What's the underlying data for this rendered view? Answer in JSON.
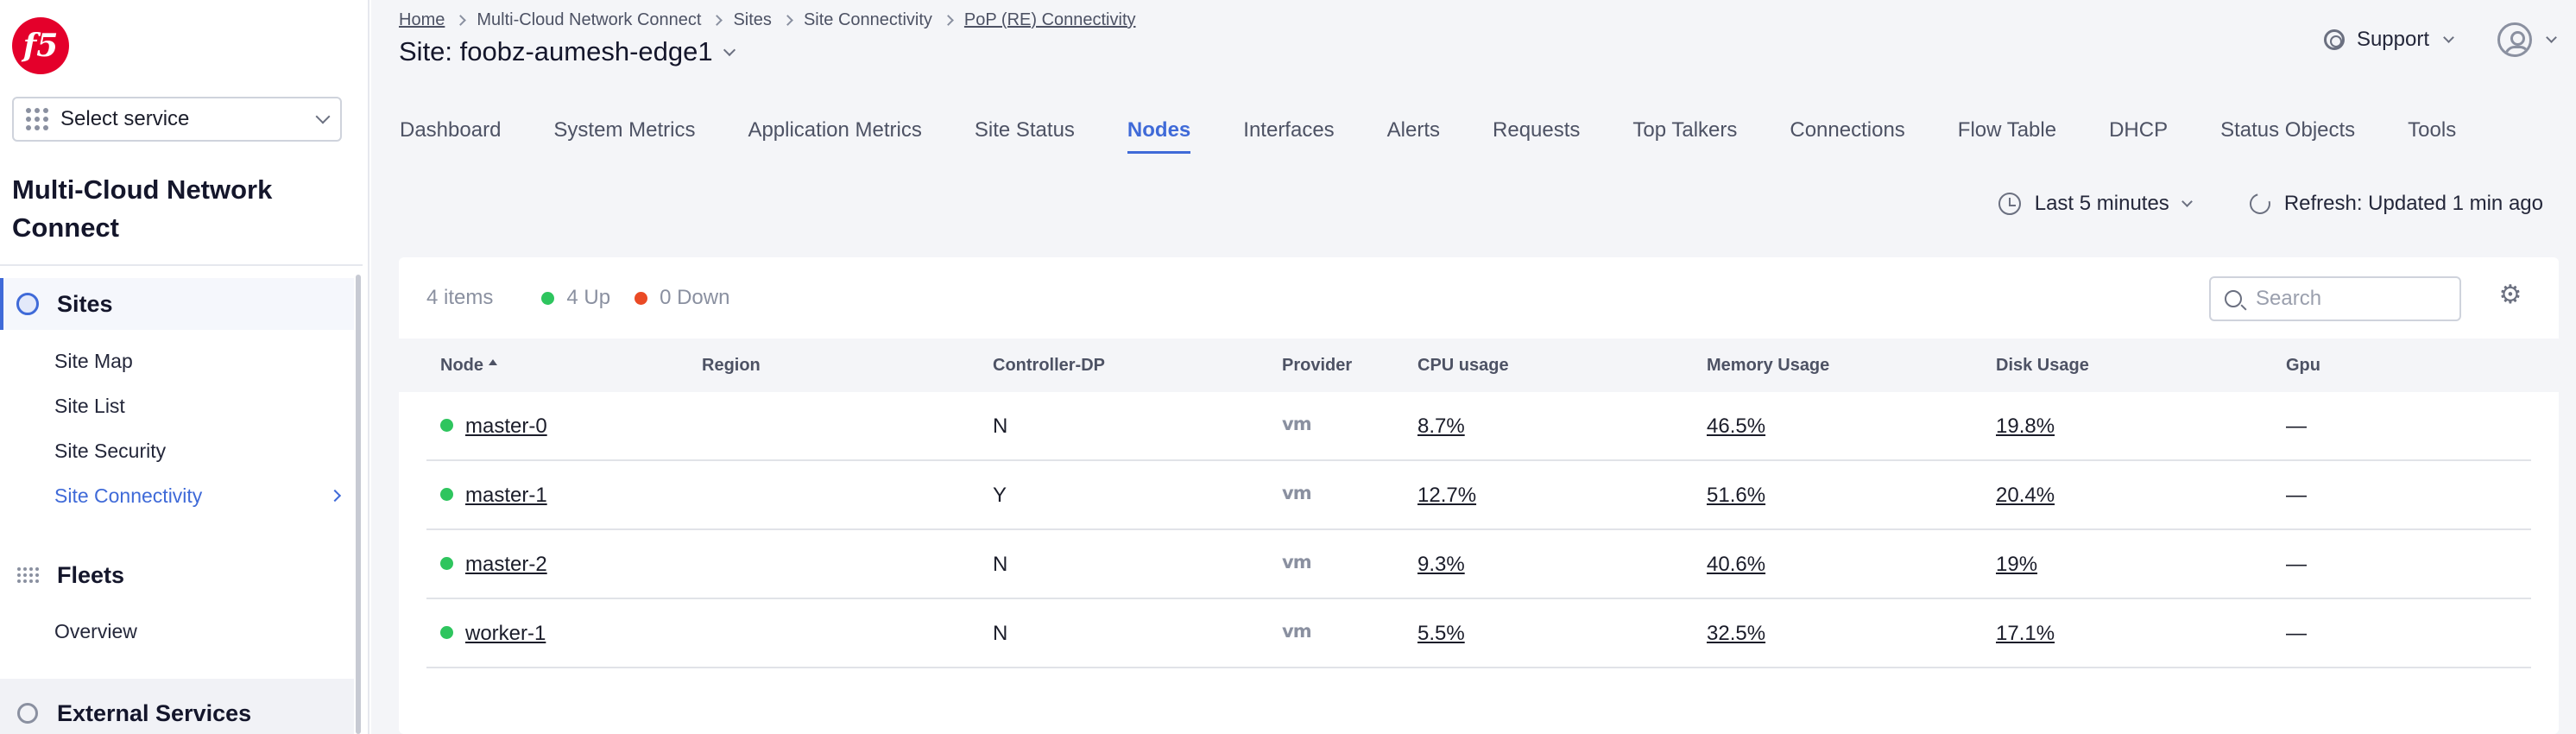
{
  "brand": {
    "logo_text": "f5"
  },
  "sidebar": {
    "service_select": "Select service",
    "workspace_title": "Multi-Cloud Network Connect",
    "groups": [
      {
        "label": "Sites",
        "icon": "sites-icon",
        "items": [
          "Site Map",
          "Site List",
          "Site Security",
          "Site Connectivity"
        ]
      },
      {
        "label": "Fleets",
        "icon": "fleets-icon",
        "items": [
          "Overview"
        ]
      },
      {
        "label": "External Services",
        "icon": "external-services-icon",
        "items": []
      }
    ],
    "active_item": "Site Connectivity"
  },
  "breadcrumb": [
    "Home",
    "Multi-Cloud Network Connect",
    "Sites",
    "Site Connectivity",
    "PoP (RE) Connectivity"
  ],
  "site_title": "Site: foobz-aumesh-edge1",
  "header": {
    "support_label": "Support"
  },
  "tabs": [
    "Dashboard",
    "System Metrics",
    "Application Metrics",
    "Site Status",
    "Nodes",
    "Interfaces",
    "Alerts",
    "Requests",
    "Top Talkers",
    "Connections",
    "Flow Table",
    "DHCP",
    "Status Objects",
    "Tools"
  ],
  "active_tab": "Nodes",
  "time_range": "Last 5 minutes",
  "refresh_label": "Refresh: Updated 1 min ago",
  "summary": {
    "count": "4 items",
    "up": "4 Up",
    "down": "0 Down"
  },
  "search": {
    "placeholder": "Search"
  },
  "table": {
    "columns": [
      "Node",
      "Region",
      "Controller-DP",
      "Provider",
      "CPU usage",
      "Memory Usage",
      "Disk Usage",
      "Gpu"
    ],
    "rows": [
      {
        "node": "master-0",
        "region": "",
        "controller_dp": "N",
        "provider": "vm",
        "cpu": "8.7%",
        "memory": "46.5%",
        "disk": "19.8%",
        "gpu": "—"
      },
      {
        "node": "master-1",
        "region": "",
        "controller_dp": "Y",
        "provider": "vm",
        "cpu": "12.7%",
        "memory": "51.6%",
        "disk": "20.4%",
        "gpu": "—"
      },
      {
        "node": "master-2",
        "region": "",
        "controller_dp": "N",
        "provider": "vm",
        "cpu": "9.3%",
        "memory": "40.6%",
        "disk": "19%",
        "gpu": "—"
      },
      {
        "node": "worker-1",
        "region": "",
        "controller_dp": "N",
        "provider": "vm",
        "cpu": "5.5%",
        "memory": "32.5%",
        "disk": "17.1%",
        "gpu": "—"
      }
    ]
  },
  "colors": {
    "accent": "#3f6ad8",
    "status_up": "#2ec55e",
    "status_down": "#ea4a25",
    "logo": "#e4002b"
  }
}
